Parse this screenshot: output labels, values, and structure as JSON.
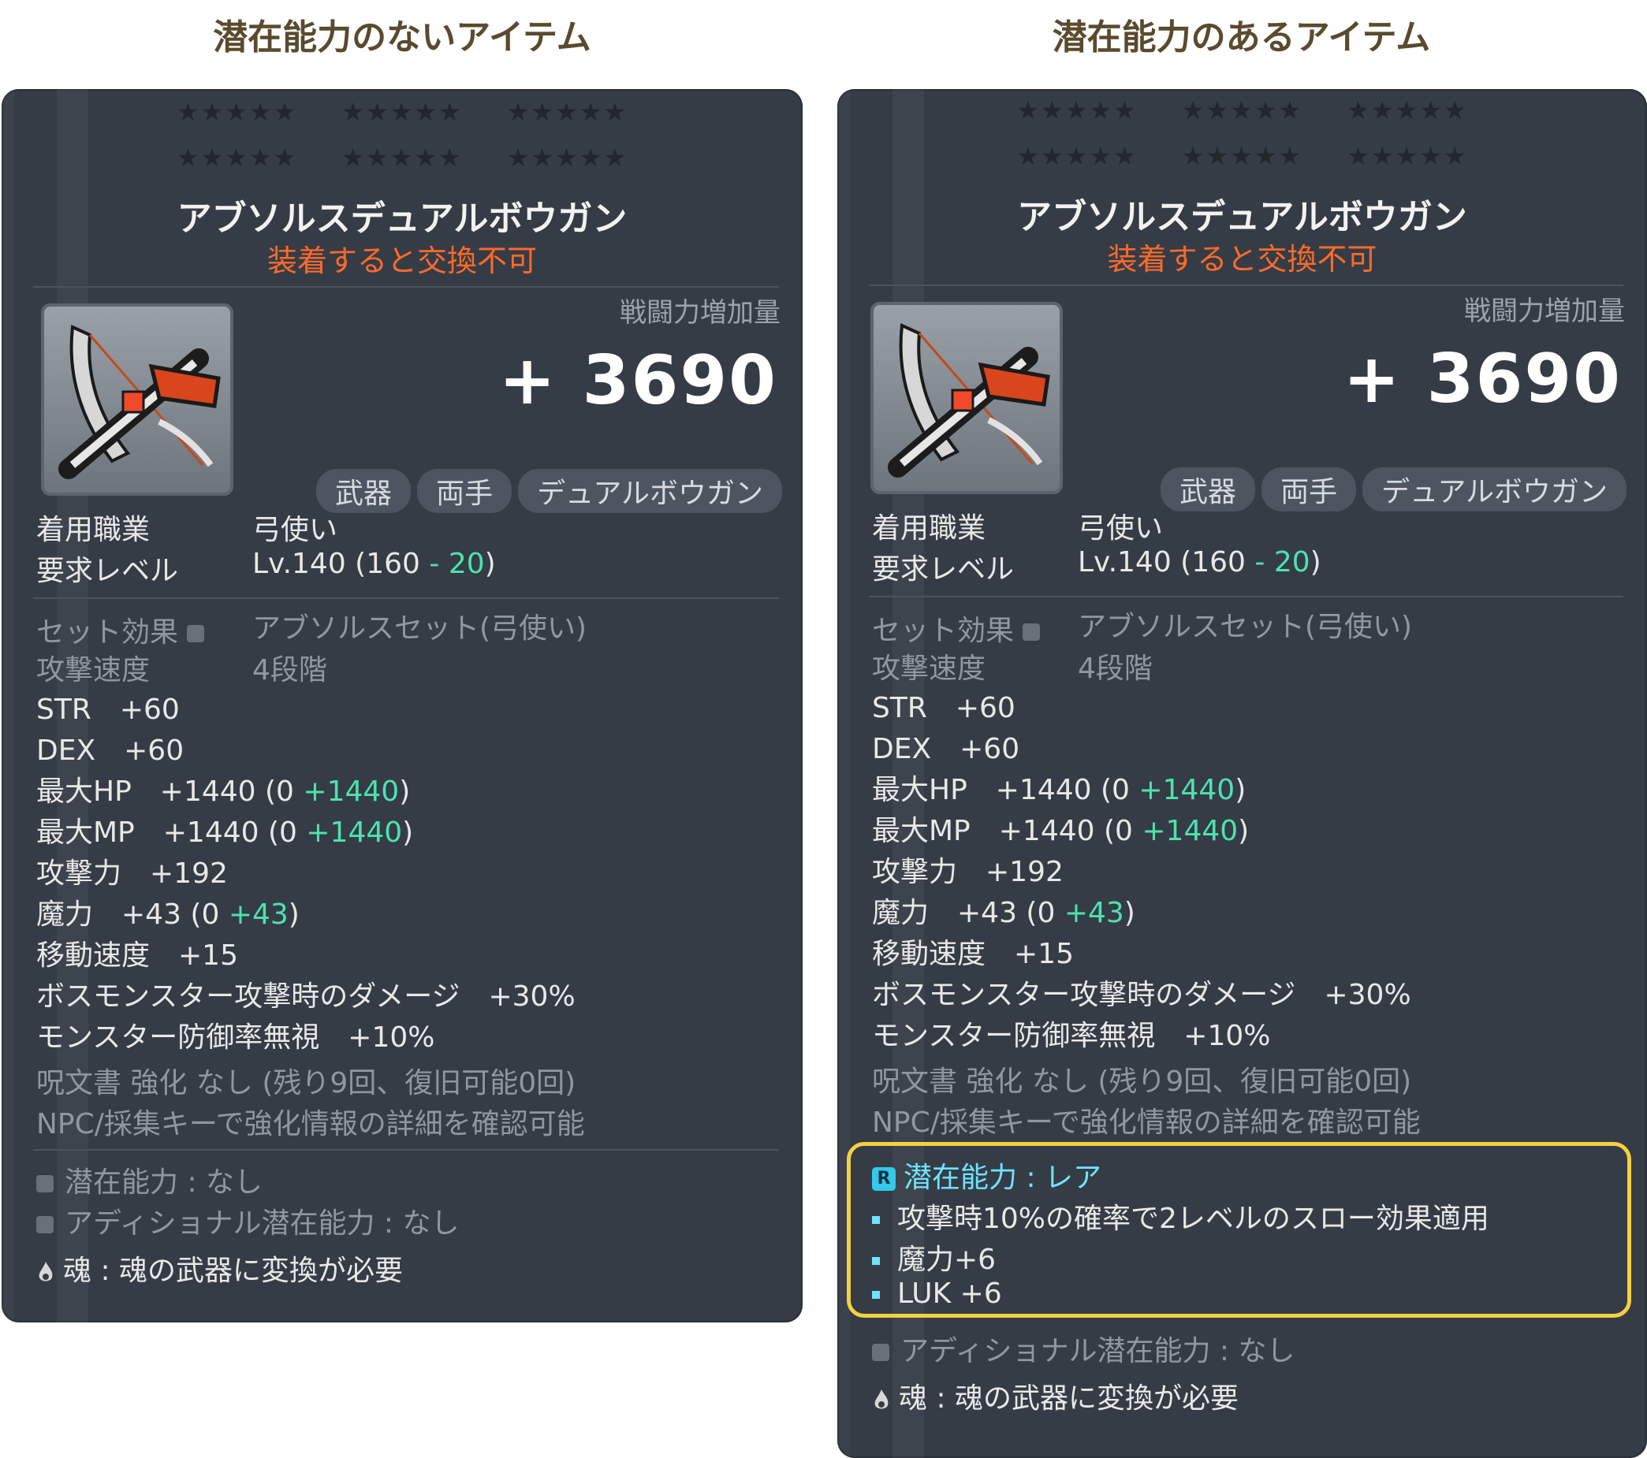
{
  "headers": {
    "left": "潜在能力のないアイテム",
    "right": "潜在能力のあるアイテム"
  },
  "stars_row": "★★★★★",
  "item": {
    "name": "アブソルスデュアルボウガン",
    "trade": "装着すると交換不可",
    "power_label": "戦闘力増加量",
    "power_value": "+ 3690",
    "tags": [
      "武器",
      "両手",
      "デュアルボウガン"
    ]
  },
  "req": {
    "job_label": "着用職業",
    "job_value": "弓使い",
    "level_label": "要求レベル",
    "level_prefix": "Lv.140 (160",
    "level_minus": " - 20",
    "level_suffix": ")"
  },
  "stats": {
    "set_label": "セット効果",
    "set_value": "アブソルスセット(弓使い)",
    "speed_label": "攻撃速度",
    "speed_value": "4段階",
    "str": "STR　+60",
    "dex": "DEX　+60",
    "hp_main": "最大HP　+1440 (0 ",
    "hp_bonus": "+1440",
    "mp_main": "最大MP　+1440 (0 ",
    "mp_bonus": "+1440",
    "close": ")",
    "atk": "攻撃力　+192",
    "mag_main": "魔力　+43 (0 ",
    "mag_bonus": "+43",
    "move": "移動速度　+15",
    "boss": "ボスモンスター攻撃時のダメージ　+30%",
    "ignore": "モンスター防御率無視　+10%",
    "scroll": "呪文書 強化 なし (残り9回、復旧可能0回)",
    "npc": "NPC/採集キーで強化情報の詳細を確認可能"
  },
  "left_potential": {
    "potential": "潜在能力 : なし",
    "additional": "アディショナル潜在能力 : なし",
    "soul": "魂 : 魂の武器に変換が必要"
  },
  "right_potential": {
    "badge": "R",
    "title": "潜在能力 : レア",
    "lines": [
      "攻撃時10%の確率で2レベルのスロー効果適用",
      "魔力+6",
      "LUK +6"
    ],
    "additional": "アディショナル潜在能力 : なし",
    "soul": "魂 : 魂の武器に変換が必要"
  },
  "colors": {
    "panel": "#353c46",
    "trade": "#ff6a2a",
    "bonus": "#4de2b0",
    "potential": "#6fe3ff",
    "highlight": "#f5d042",
    "header": "#5a4a2e"
  }
}
